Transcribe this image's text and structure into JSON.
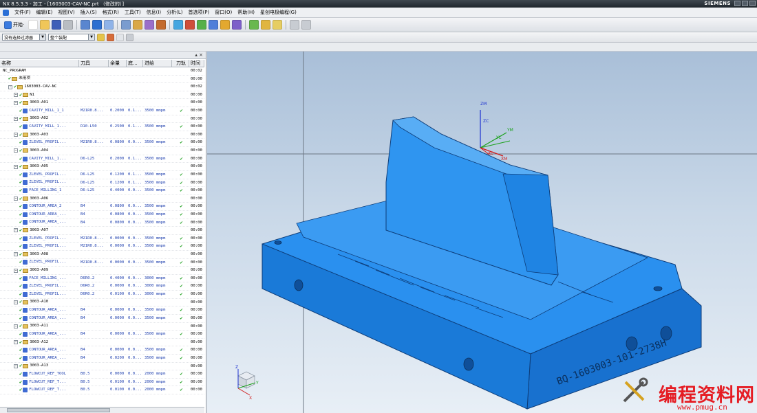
{
  "window": {
    "title": "NX 8.5.3.3 - 加工 - [1603003-CAV-NC.prt （修改的）]",
    "brand": "SIEMENS"
  },
  "menu": [
    "文件(F)",
    "编辑(E)",
    "视图(V)",
    "插入(S)",
    "格式(R)",
    "工具(T)",
    "信息(I)",
    "分析(L)",
    "首选项(P)",
    "窗口(O)",
    "帮助(H)",
    "星创电极编程(G)"
  ],
  "toolbar": {
    "start_label": "开始·",
    "filter_value": "没有选择过滤器",
    "assembly_value": "整个装配"
  },
  "navigator": {
    "columns": [
      "名称",
      "刀具",
      "余量",
      "底...",
      "进给",
      "刀轨",
      "时间"
    ],
    "rows": [
      {
        "level": 0,
        "kind": "root",
        "name": "NC_PROGRAM",
        "tool": "",
        "stock": "",
        "floor": "",
        "feed": "",
        "path": "",
        "time": "00:02"
      },
      {
        "level": 1,
        "kind": "folder",
        "name": "未用项",
        "tool": "",
        "stock": "",
        "floor": "",
        "feed": "",
        "path": "",
        "time": "00:00"
      },
      {
        "level": 1,
        "kind": "group",
        "name": "1603003-CAV-NC",
        "tool": "",
        "stock": "",
        "floor": "",
        "feed": "",
        "path": "",
        "time": "00:02"
      },
      {
        "level": 2,
        "kind": "group",
        "name": "N1",
        "tool": "",
        "stock": "",
        "floor": "",
        "feed": "",
        "path": "",
        "time": "00:00"
      },
      {
        "level": 2,
        "kind": "group",
        "name": "3003-A01",
        "tool": "",
        "stock": "",
        "floor": "",
        "feed": "",
        "path": "",
        "time": "00:00"
      },
      {
        "level": 3,
        "kind": "op",
        "name": "CAVITY_MILL_1_1",
        "tool": "M21R0.8...",
        "stock": "0.2000",
        "floor": "0.1...",
        "feed": "3500 mmpm",
        "path": "✔",
        "time": "00:00"
      },
      {
        "level": 2,
        "kind": "group",
        "name": "3003-A02",
        "tool": "",
        "stock": "",
        "floor": "",
        "feed": "",
        "path": "",
        "time": "00:00"
      },
      {
        "level": 3,
        "kind": "op",
        "name": "CAVITY_MILL_1...",
        "tool": "D10-L50",
        "stock": "0.2500",
        "floor": "0.1...",
        "feed": "3500 mmpm",
        "path": "✔",
        "time": "00:00"
      },
      {
        "level": 2,
        "kind": "group",
        "name": "3003-A03",
        "tool": "",
        "stock": "",
        "floor": "",
        "feed": "",
        "path": "",
        "time": "00:00"
      },
      {
        "level": 3,
        "kind": "op",
        "name": "ZLEVEL_PROFIL...",
        "tool": "M21R0.8...",
        "stock": "0.0800",
        "floor": "0.0...",
        "feed": "3500 mmpm",
        "path": "✔",
        "time": "00:00"
      },
      {
        "level": 2,
        "kind": "group",
        "name": "3003-A04",
        "tool": "",
        "stock": "",
        "floor": "",
        "feed": "",
        "path": "",
        "time": "00:00"
      },
      {
        "level": 3,
        "kind": "op",
        "name": "CAVITY_MILL_1...",
        "tool": "D6-L25",
        "stock": "0.2000",
        "floor": "0.1...",
        "feed": "3500 mmpm",
        "path": "✔",
        "time": "00:00"
      },
      {
        "level": 2,
        "kind": "group",
        "name": "3003-A05",
        "tool": "",
        "stock": "",
        "floor": "",
        "feed": "",
        "path": "",
        "time": "00:00"
      },
      {
        "level": 3,
        "kind": "op",
        "name": "ZLEVEL_PROFIL...",
        "tool": "D6-L25",
        "stock": "0.1200",
        "floor": "0.1...",
        "feed": "3500 mmpm",
        "path": "✔",
        "time": "00:00"
      },
      {
        "level": 3,
        "kind": "op",
        "name": "ZLEVEL_PROFIL...",
        "tool": "D6-L25",
        "stock": "0.1200",
        "floor": "0.1...",
        "feed": "3500 mmpm",
        "path": "✔",
        "time": "00:00"
      },
      {
        "level": 3,
        "kind": "op",
        "name": "FACE_MILLING_1",
        "tool": "D6-L25",
        "stock": "0.4000",
        "floor": "0.0...",
        "feed": "3500 mmpm",
        "path": "✔",
        "time": "00:00"
      },
      {
        "level": 2,
        "kind": "group",
        "name": "3003-A06",
        "tool": "",
        "stock": "",
        "floor": "",
        "feed": "",
        "path": "",
        "time": "00:00"
      },
      {
        "level": 3,
        "kind": "op",
        "name": "CONTOUR_AREA_2",
        "tool": "B4",
        "stock": "0.0800",
        "floor": "0.0...",
        "feed": "3500 mmpm",
        "path": "✔",
        "time": "00:00"
      },
      {
        "level": 3,
        "kind": "op",
        "name": "CONTOUR_AREA_...",
        "tool": "B4",
        "stock": "0.0800",
        "floor": "0.0...",
        "feed": "3500 mmpm",
        "path": "✔",
        "time": "00:00"
      },
      {
        "level": 3,
        "kind": "op",
        "name": "CONTOUR_AREA_...",
        "tool": "B4",
        "stock": "0.0800",
        "floor": "0.0...",
        "feed": "3500 mmpm",
        "path": "✔",
        "time": "00:00"
      },
      {
        "level": 2,
        "kind": "group",
        "name": "3003-A07",
        "tool": "",
        "stock": "",
        "floor": "",
        "feed": "",
        "path": "",
        "time": "00:00"
      },
      {
        "level": 3,
        "kind": "op",
        "name": "ZLEVEL_PROFIL...",
        "tool": "M21R0.8...",
        "stock": "0.0000",
        "floor": "0.0...",
        "feed": "3500 mmpm",
        "path": "✔",
        "time": "00:00"
      },
      {
        "level": 3,
        "kind": "op",
        "name": "ZLEVEL_PROFIL...",
        "tool": "M21R0.8...",
        "stock": "0.0000",
        "floor": "0.0...",
        "feed": "3500 mmpm",
        "path": "✔",
        "time": "00:00"
      },
      {
        "level": 2,
        "kind": "group",
        "name": "3003-A08",
        "tool": "",
        "stock": "",
        "floor": "",
        "feed": "",
        "path": "",
        "time": "00:00"
      },
      {
        "level": 3,
        "kind": "op",
        "name": "ZLEVEL_PROFIL...",
        "tool": "M21R0.8...",
        "stock": "0.0000",
        "floor": "0.0...",
        "feed": "3500 mmpm",
        "path": "✔",
        "time": "00:00"
      },
      {
        "level": 2,
        "kind": "group",
        "name": "3003-A09",
        "tool": "",
        "stock": "",
        "floor": "",
        "feed": "",
        "path": "",
        "time": "00:00"
      },
      {
        "level": 3,
        "kind": "op",
        "name": "FACE_MILLING_...",
        "tool": "D6R0.2",
        "stock": "0.4000",
        "floor": "0.0...",
        "feed": "3000 mmpm",
        "path": "✔",
        "time": "00:00"
      },
      {
        "level": 3,
        "kind": "op",
        "name": "ZLEVEL_PROFIL...",
        "tool": "D6R0.2",
        "stock": "0.0000",
        "floor": "0.0...",
        "feed": "3000 mmpm",
        "path": "✔",
        "time": "00:00"
      },
      {
        "level": 3,
        "kind": "op",
        "name": "ZLEVEL_PROFIL...",
        "tool": "D6R0.2",
        "stock": "0.0100",
        "floor": "0.0...",
        "feed": "3000 mmpm",
        "path": "✔",
        "time": "00:00"
      },
      {
        "level": 2,
        "kind": "group",
        "name": "3003-A10",
        "tool": "",
        "stock": "",
        "floor": "",
        "feed": "",
        "path": "",
        "time": "00:00"
      },
      {
        "level": 3,
        "kind": "op",
        "name": "CONTOUR_AREA_...",
        "tool": "B4",
        "stock": "0.0000",
        "floor": "0.0...",
        "feed": "3500 mmpm",
        "path": "✔",
        "time": "00:00"
      },
      {
        "level": 3,
        "kind": "op",
        "name": "CONTOUR_AREA_...",
        "tool": "B4",
        "stock": "0.0000",
        "floor": "0.0...",
        "feed": "3500 mmpm",
        "path": "✔",
        "time": "00:00"
      },
      {
        "level": 2,
        "kind": "group",
        "name": "3003-A11",
        "tool": "",
        "stock": "",
        "floor": "",
        "feed": "",
        "path": "",
        "time": "00:00"
      },
      {
        "level": 3,
        "kind": "op",
        "name": "CONTOUR_AREA_...",
        "tool": "B4",
        "stock": "0.0000",
        "floor": "0.0...",
        "feed": "3500 mmpm",
        "path": "✔",
        "time": "00:00"
      },
      {
        "level": 2,
        "kind": "group",
        "name": "3003-A12",
        "tool": "",
        "stock": "",
        "floor": "",
        "feed": "",
        "path": "",
        "time": "00:00"
      },
      {
        "level": 3,
        "kind": "op",
        "name": "CONTOUR_AREA_...",
        "tool": "B4",
        "stock": "0.0000",
        "floor": "0.0...",
        "feed": "3500 mmpm",
        "path": "✔",
        "time": "00:00"
      },
      {
        "level": 3,
        "kind": "op",
        "name": "CONTOUR_AREA_...",
        "tool": "B4",
        "stock": "0.0200",
        "floor": "0.0...",
        "feed": "3500 mmpm",
        "path": "✔",
        "time": "00:00"
      },
      {
        "level": 2,
        "kind": "group",
        "name": "3003-A13",
        "tool": "",
        "stock": "",
        "floor": "",
        "feed": "",
        "path": "",
        "time": "00:00"
      },
      {
        "level": 3,
        "kind": "op",
        "name": "FLOWCUT_REF_TOOL",
        "tool": "B0.5",
        "stock": "0.0000",
        "floor": "0.0...",
        "feed": "2000 mmpm",
        "path": "✔",
        "time": "00:00"
      },
      {
        "level": 3,
        "kind": "op",
        "name": "FLOWCUT_REF_T...",
        "tool": "B0.5",
        "stock": "0.0100",
        "floor": "0.0...",
        "feed": "2000 mmpm",
        "path": "✔",
        "time": "00:00"
      },
      {
        "level": 3,
        "kind": "op",
        "name": "FLOWCUT_REF_T...",
        "tool": "B0.5",
        "stock": "0.0100",
        "floor": "0.0...",
        "feed": "2000 mmpm",
        "path": "✔",
        "time": "00:00"
      }
    ]
  },
  "viewport": {
    "axes": {
      "zm": "ZM",
      "zc": "ZC",
      "ym": "YM",
      "yc": "YC",
      "xc": "XC",
      "xm": "XM"
    },
    "triad": {
      "z": "Z",
      "y": "Y",
      "x": "X"
    },
    "part_engraving": "BQ-1603003-101-2738H",
    "part_color": "#1f86e6"
  },
  "watermark": {
    "title": "编程资料网",
    "url": "www.pmug.cn"
  }
}
